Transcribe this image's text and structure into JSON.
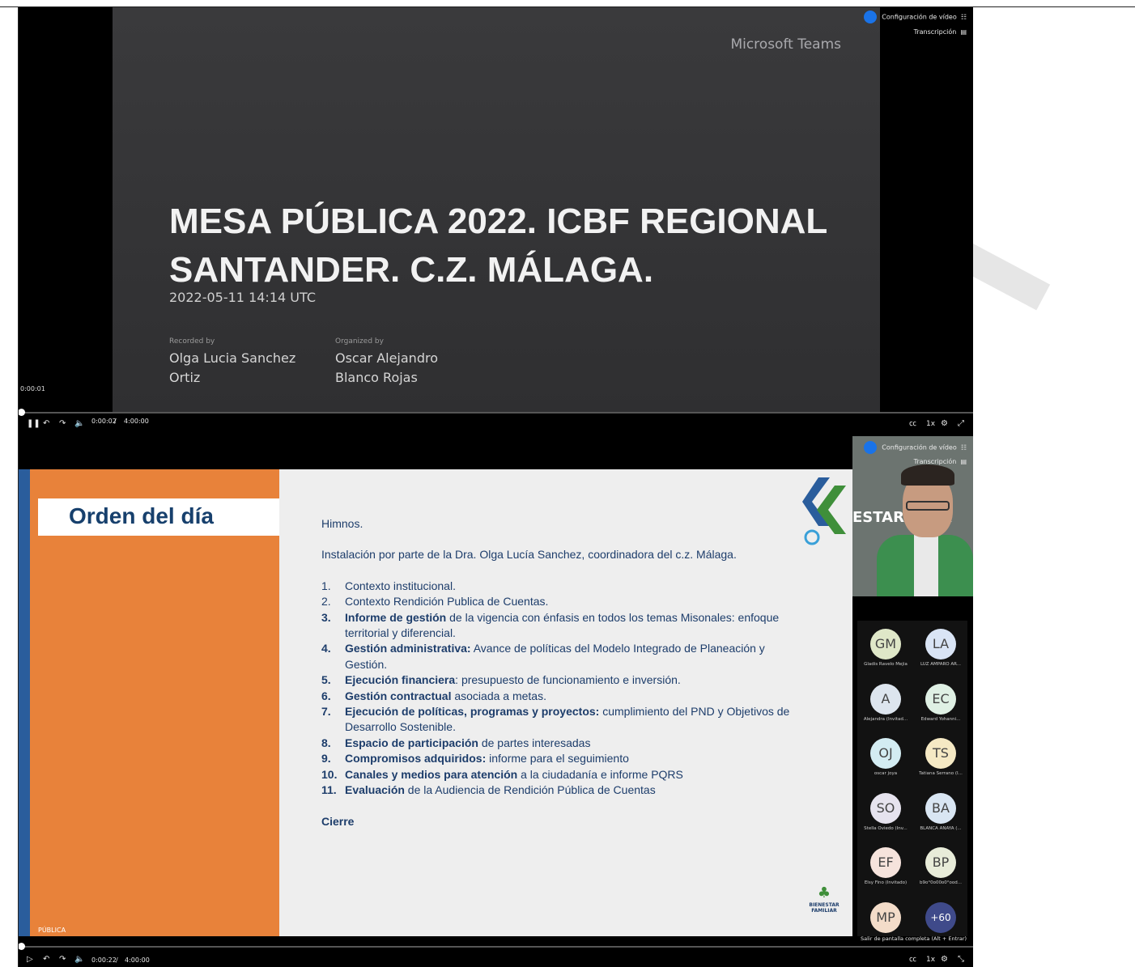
{
  "player1": {
    "brand": "Microsoft Teams",
    "title": "MESA PÚBLICA 2022. ICBF REGIONAL SANTANDER. C.Z. MÁLAGA.",
    "date": "2022-05-11 14:14 UTC",
    "recorded_label": "Recorded by",
    "recorded_name": "Olga Lucia Sanchez Ortiz",
    "organized_label": "Organized by",
    "organized_name": "Oscar Alejandro Blanco Rojas",
    "tooltip_time": "0:00:01",
    "current_time": "0:00:02",
    "total_time": "4:00:00",
    "speed": "1x",
    "video_settings": "Configuración de vídeo",
    "transcription": "Transcripción",
    "progress_fraction": 0.0001
  },
  "player2": {
    "current_time": "0:00:22",
    "total_time": "4:00:00",
    "speed": "1x",
    "video_settings": "Configuración de vídeo",
    "transcription": "Transcripción",
    "exit_fullscreen": "Salir de pantalla completa (Alt + Entrar)",
    "progress_fraction": 0.0015
  },
  "slide": {
    "title": "Orden del día",
    "footer": "PÚBLICA",
    "intro1": "Himnos.",
    "intro2": "Instalación por parte de la Dra. Olga Lucía Sanchez, coordinadora del c.z. Málaga.",
    "items": [
      {
        "num": "1.",
        "bold": "",
        "text": "Contexto institucional."
      },
      {
        "num": "2.",
        "bold": "",
        "text": "Contexto Rendición Publica de Cuentas."
      },
      {
        "num": "3.",
        "bold": "Informe de gestión",
        "text": " de la vigencia con énfasis en todos los temas Misonales: enfoque territorial y diferencial."
      },
      {
        "num": "4.",
        "bold": "Gestión administrativa:",
        "text": " Avance de políticas del Modelo Integrado de Planeación y Gestión."
      },
      {
        "num": "5.",
        "bold": "Ejecución financiera",
        "text": ": presupuesto de funcionamiento e inversión."
      },
      {
        "num": "6.",
        "bold": "Gestión contractual",
        "text": " asociada a metas."
      },
      {
        "num": "7.",
        "bold": "Ejecución de políticas, programas y proyectos:",
        "text": " cumplimiento del PND y Objetivos de Desarrollo Sostenible."
      },
      {
        "num": "8.",
        "bold": "Espacio de participación",
        "text": " de partes interesadas"
      },
      {
        "num": "9.",
        "bold": "Compromisos adquiridos:",
        "text": " informe para el seguimiento"
      },
      {
        "num": "10.",
        "bold": "Canales y medios para atención",
        "text": " a la ciudadanía e informe PQRS"
      },
      {
        "num": "11.",
        "bold": "Evaluación",
        "text": " de la Audiencia de Rendición Pública de Cuentas"
      }
    ],
    "closing": "Cierre",
    "logo_text": "BIENESTAR FAMILIAR",
    "cam_bg_text": "ESTAR ILIAR"
  },
  "participants": [
    {
      "initials": "GM",
      "name": "Gladis Ravelo Mejia",
      "color": "#dfe7c8"
    },
    {
      "initials": "LA",
      "name": "LUZ AMPARO AR...",
      "color": "#d9e4f5"
    },
    {
      "initials": "A",
      "name": "Alejandra (Invitad...",
      "color": "#dde5ee"
    },
    {
      "initials": "EC",
      "name": "Edward Yohanni...",
      "color": "#dff0e4"
    },
    {
      "initials": "OJ",
      "name": "oscar joya",
      "color": "#d3ecf2"
    },
    {
      "initials": "TS",
      "name": "Tatiana Serrano (I...",
      "color": "#f5e9c4"
    },
    {
      "initials": "SO",
      "name": "Stella Oviedo (Inv...",
      "color": "#e6e3ee"
    },
    {
      "initials": "BA",
      "name": "BLANCA ANAYA (...",
      "color": "#d9e6f3"
    },
    {
      "initials": "EF",
      "name": "Elsy Fino (Invitado)",
      "color": "#f6e3dc"
    },
    {
      "initials": "BP",
      "name": "b9o°0o00o0°ood...",
      "color": "#e8ecd9"
    },
    {
      "initials": "MP",
      "name": "",
      "color": "#f3dcc9"
    },
    {
      "initials": "+60",
      "name": "",
      "color": "#3f4a8a"
    }
  ]
}
